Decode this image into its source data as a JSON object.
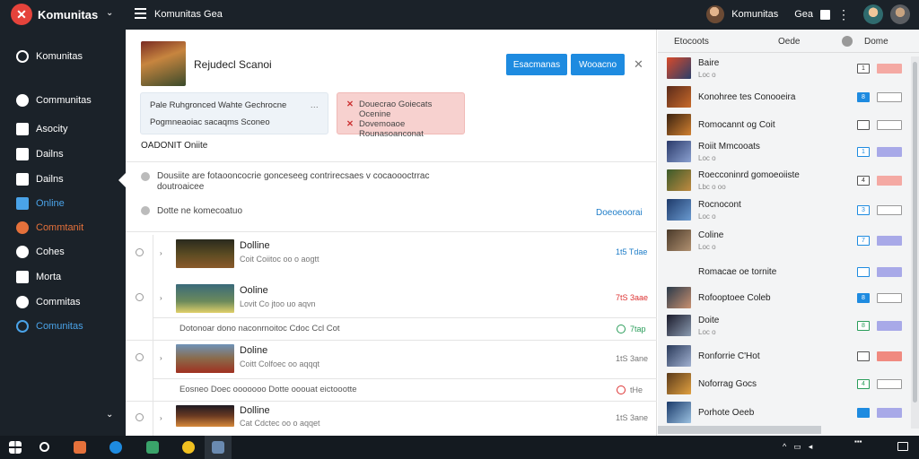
{
  "topbar": {
    "brand": "Komunitas",
    "app_title": "Komunitas Gea",
    "user_name": "Komunitas",
    "user_short": "Gea"
  },
  "sidebar": {
    "items": [
      {
        "label": "Komunitas",
        "icon": "recent-icon"
      },
      {
        "label": "Communitas",
        "icon": "community-icon"
      },
      {
        "label": "Asocity",
        "icon": "activity-icon"
      },
      {
        "label": "Dailns",
        "icon": "daily-icon"
      },
      {
        "label": "Dailns",
        "icon": "daily-icon-2"
      },
      {
        "label": "Online",
        "icon": "online-icon"
      },
      {
        "label": "Commtanit",
        "icon": "comment-icon"
      },
      {
        "label": "Cohes",
        "icon": "codes-icon"
      },
      {
        "label": "Morta",
        "icon": "portal-icon"
      },
      {
        "label": "Commitas",
        "icon": "commit-icon"
      },
      {
        "label": "Comunitas",
        "icon": "communitas-icon"
      }
    ]
  },
  "header": {
    "title": "Rejudecl Scanoi",
    "primary_button": "Esacmanas",
    "secondary_button": "Wooacno"
  },
  "info_box": {
    "line1": "Pale Ruhgronced Wahte Gechrocne",
    "line2": "Pogmneaoiac sacaqms Sconeo"
  },
  "warn_box": {
    "line1": "Douecrao Goiecats Ocenine",
    "line2": "Dovemoaoe",
    "line3": "Rounasoanconat"
  },
  "section_title": "OADONIT Oniite",
  "description": "Dousiite are fotaooncocrie gonceseeg contrirecsaes v cocaoooctrrac doutroaicee",
  "subnote": {
    "text": "Dotte ne komecoatuo",
    "link": "Doeoeoorai"
  },
  "rows": [
    {
      "title": "Dolline",
      "sub": "Coit Coiitoc oo o aogtt",
      "value": "1t5 Tdae"
    },
    {
      "title": "Ooline",
      "sub": "Lovit Co jtoo uo aqvn",
      "value": "7tS 3aae"
    },
    {
      "title": "Doline",
      "sub": "Coitt Colfoec oo aqqqt",
      "value": "1tS 3ane"
    }
  ],
  "subrows": [
    {
      "text": "Dotonoar dono naconrnoitoc Cdoc Ccl Cot",
      "value": "7tap"
    },
    {
      "text": "Eosneo Doec ooooooo Dotte ooouat eictoootte",
      "value": "tHe"
    }
  ],
  "last_row": {
    "title": "Dolline",
    "sub": "Cat Cdctec oo o aqqet",
    "value": "1tS 3ane"
  },
  "right_panel": {
    "header": {
      "left": "Etocoots",
      "mid": "Oede",
      "right": "Dome"
    },
    "items": [
      {
        "title": "Baire",
        "sub": "Loc o",
        "chk": "1",
        "thumb": "g1"
      },
      {
        "title": "Konohree tes Conooeira",
        "sub": "",
        "chk": "8",
        "thumb": "g2"
      },
      {
        "title": "Romocannt og Coit",
        "sub": "",
        "chk": "",
        "thumb": "g3"
      },
      {
        "title": "Roiit Mmcooats",
        "sub": "Loc o",
        "chk": "1",
        "thumb": "g4"
      },
      {
        "title": "Roecconinrd gomoeoiiste",
        "sub": "Lbc o oo",
        "chk": "4",
        "thumb": "g5"
      },
      {
        "title": "Rocnocont",
        "sub": "Loc o",
        "chk": "3",
        "thumb": "g6"
      },
      {
        "title": "Coline",
        "sub": "Loc o",
        "chk": "7",
        "thumb": "g7"
      },
      {
        "title": "Romacae oe tornite",
        "sub": "",
        "chk": "",
        "thumb": ""
      },
      {
        "title": "Rofooptoee Coleb",
        "sub": "",
        "chk": "8",
        "thumb": "g8"
      },
      {
        "title": "Doite",
        "sub": "Loc o",
        "chk": "8",
        "thumb": "g9"
      },
      {
        "title": "Ronforrie C'Hot",
        "sub": "",
        "chk": "",
        "thumb": "g10"
      },
      {
        "title": "Noforrag Gocs",
        "sub": "",
        "chk": "4",
        "thumb": "g11"
      },
      {
        "title": "Porhote Oeeb",
        "sub": "",
        "chk": "",
        "thumb": "g12"
      }
    ]
  },
  "colors": {
    "accent": "#1e8be0",
    "sidebar_bg": "#1b2229",
    "brand": "#e5433b",
    "warn_bg": "#f7d1cf",
    "info_bg": "#eef3f8"
  }
}
